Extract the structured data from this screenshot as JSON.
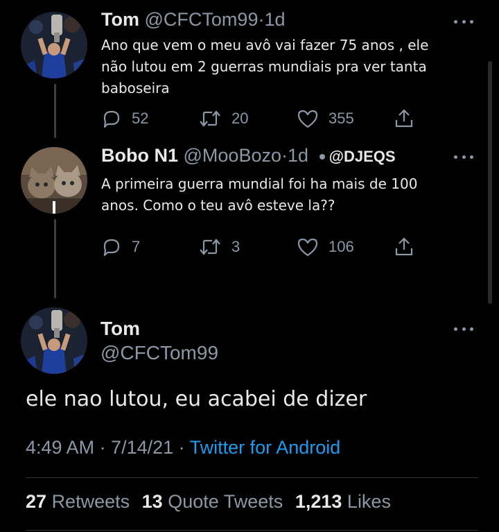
{
  "tweet1": {
    "name": "Tom",
    "handle": "@CFCTom99",
    "separator": "·",
    "time": "1d",
    "text_lines": [
      "Ano que vem o meu avô vai fazer 75 anos , ele",
      "não lutou em 2 guerras mundiais pra ver tanta",
      "baboseira"
    ],
    "replies": "52",
    "retweets": "20",
    "likes": "355"
  },
  "tweet2": {
    "name": "Bobo N1",
    "handle": "@MooBozo",
    "separator": "·",
    "time": "1d",
    "mention": "@DJEQS",
    "text_lines": [
      "A primeira guerra mundial foi  ha mais de 100",
      "anos. Como o teu avô esteve la??"
    ],
    "replies": "7",
    "retweets": "3",
    "likes": "106"
  },
  "main_tweet": {
    "name": "Tom",
    "handle": "@CFCTom99",
    "text": "ele nao lutou, eu acabei de dizer",
    "timestamp": "4:49 AM · 7/14/21 · ",
    "source": "Twitter for Android",
    "retweets_count": "27",
    "retweets_label": "Retweets",
    "quotes_count": "13",
    "quotes_label": "Quote Tweets",
    "likes_count": "1,213",
    "likes_label": "Likes"
  },
  "icons": {
    "reply": "reply-icon",
    "retweet": "retweet-icon",
    "like": "heart-icon",
    "share": "share-icon",
    "more": "more-options-icon"
  },
  "colors": {
    "background": "#000000",
    "text": "#e7e9ea",
    "secondary": "#8b98a5",
    "link": "#1d9bf0"
  }
}
